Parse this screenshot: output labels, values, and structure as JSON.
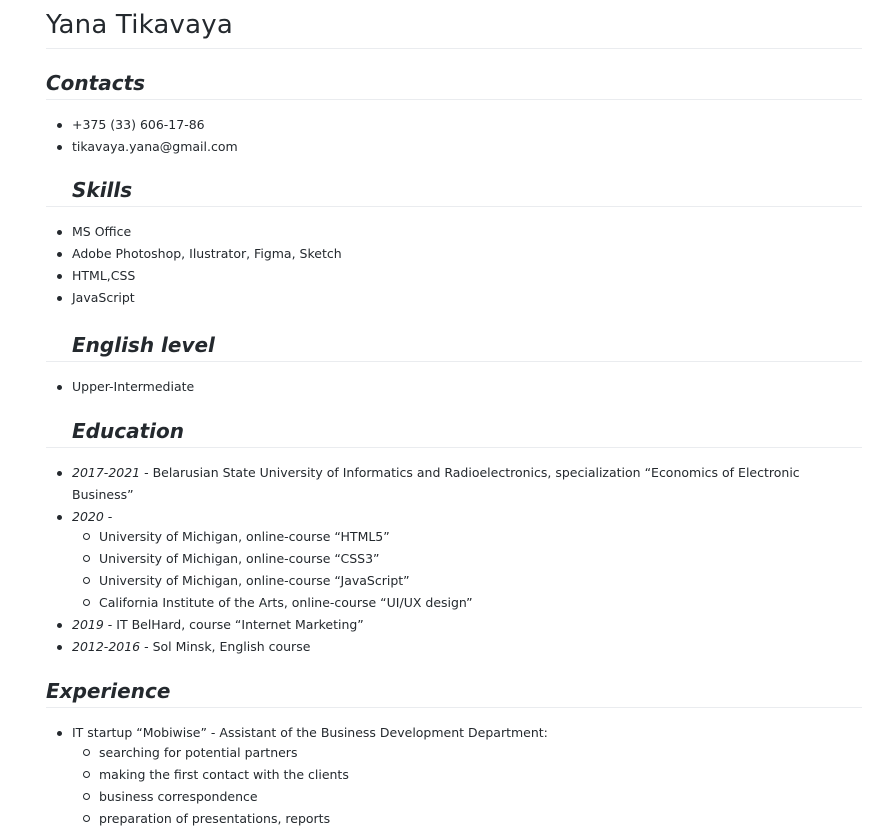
{
  "name": "Yana Tikavaya",
  "contacts": {
    "heading": "Contacts",
    "items": [
      "+375 (33) 606-17-86",
      "tikavaya.yana@gmail.com"
    ]
  },
  "skills": {
    "heading": "Skills",
    "items": [
      "MS Office",
      "Adobe Photoshop, Ilustrator, Figma, Sketch",
      "HTML,CSS",
      "JavaScript"
    ]
  },
  "english": {
    "heading": "English level",
    "items": [
      "Upper-Intermediate"
    ]
  },
  "education": {
    "heading": "Education",
    "items": [
      {
        "period": "2017-2021",
        "text": " - Belarusian State University of Informatics and Radioelectronics, specialization “Economics of Electronic Business”"
      },
      {
        "period": "2020 -",
        "text": "",
        "sub": [
          "University of Michigan, online-course “HTML5”",
          "University of Michigan, online-course “CSS3”",
          "University of Michigan, online-course “JavaScript”",
          "California Institute of the Arts, online-course “UI/UX design”"
        ]
      },
      {
        "period": "2019",
        "text": " - IT BelHard, course “Internet Marketing”"
      },
      {
        "period": "2012-2016",
        "text": " - Sol Minsk, English course"
      }
    ]
  },
  "experience": {
    "heading": "Experience",
    "items": [
      {
        "text": "IT startup “Mobiwise” - Assistant of the Business Development Department:",
        "sub": [
          "searching for potential partners",
          "making the first contact with the clients",
          "business correspondence",
          "preparation of presentations, reports"
        ]
      }
    ]
  }
}
